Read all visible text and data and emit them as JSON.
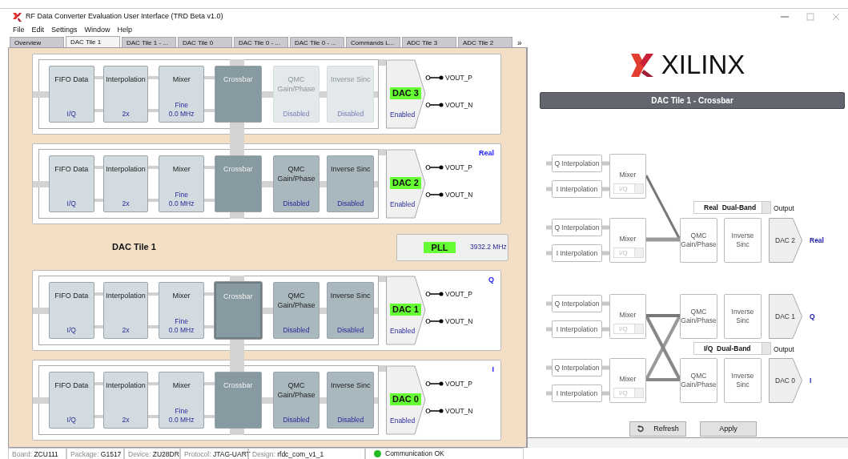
{
  "window": {
    "title": "RF Data Converter Evaluation User Interface (TRD Beta v1.0)"
  },
  "menu": [
    "File",
    "Edit",
    "Settings",
    "Window",
    "Help"
  ],
  "tabs": [
    {
      "label": "Overview",
      "selected": false
    },
    {
      "label": "DAC Tile 1",
      "selected": true
    },
    {
      "label": "DAC Tile 1 - ...",
      "selected": false
    },
    {
      "label": "DAC Tile 0",
      "selected": false
    },
    {
      "label": "DAC Tile 0 - ...",
      "selected": false
    },
    {
      "label": "DAC Tile 0 - ...",
      "selected": false
    },
    {
      "label": "Commands L...",
      "selected": false
    },
    {
      "label": "ADC Tile 3",
      "selected": false
    },
    {
      "label": "ADC Tile 2",
      "selected": false
    }
  ],
  "tabs_more": "»",
  "dac_tile": {
    "label": "DAC Tile 1",
    "pll": {
      "label": "PLL",
      "frequency": "3932.2 MHz"
    },
    "pairs": [
      [
        {
          "fifo": {
            "title": "FIFO Data",
            "value": "I/Q"
          },
          "interpolation": {
            "title": "Interpolation",
            "value": "2x"
          },
          "mixer": {
            "title": "Mixer",
            "value": "Fine",
            "frequency": "0.0 MHz"
          },
          "crossbar": {
            "title": "Crossbar",
            "selected": false
          },
          "qmc": {
            "title": "QMC Gain/Phase",
            "value": "Disabled",
            "disabled": true
          },
          "inverse_sinc": {
            "title": "Inverse Sinc",
            "value": "Disabled",
            "disabled": true
          },
          "dac": {
            "name": "DAC 3",
            "status": "Enabled"
          },
          "outputs": [
            "VOUT_P",
            "VOUT_N"
          ]
        },
        {
          "tag": "Real",
          "fifo": {
            "title": "FIFO Data",
            "value": "I/Q"
          },
          "interpolation": {
            "title": "Interpolation",
            "value": "2x"
          },
          "mixer": {
            "title": "Mixer",
            "value": "Fine",
            "frequency": "0.0 MHz"
          },
          "crossbar": {
            "title": "Crossbar",
            "selected": false
          },
          "qmc": {
            "title": "QMC Gain/Phase",
            "value": "Disabled",
            "disabled": false
          },
          "inverse_sinc": {
            "title": "Inverse Sinc",
            "value": "Disabled",
            "disabled": false
          },
          "dac": {
            "name": "DAC 2",
            "status": "Enabled"
          },
          "outputs": [
            "VOUT_P",
            "VOUT_N"
          ]
        }
      ],
      [
        {
          "tag": "Q",
          "fifo": {
            "title": "FIFO Data",
            "value": "I/Q"
          },
          "interpolation": {
            "title": "Interpolation",
            "value": "2x"
          },
          "mixer": {
            "title": "Mixer",
            "value": "Fine",
            "frequency": "0.0 MHz"
          },
          "crossbar": {
            "title": "Crossbar",
            "selected": true
          },
          "qmc": {
            "title": "QMC Gain/Phase",
            "value": "Disabled",
            "disabled": false
          },
          "inverse_sinc": {
            "title": "Inverse Sinc",
            "value": "Disabled",
            "disabled": false
          },
          "dac": {
            "name": "DAC 1",
            "status": "Enabled"
          },
          "outputs": [
            "VOUT_P",
            "VOUT_N"
          ]
        },
        {
          "tag": "I",
          "fifo": {
            "title": "FIFO Data",
            "value": "I/Q"
          },
          "interpolation": {
            "title": "Interpolation",
            "value": "2x"
          },
          "mixer": {
            "title": "Mixer",
            "value": "Fine",
            "frequency": "0.0 MHz"
          },
          "crossbar": {
            "title": "Crossbar",
            "selected": false
          },
          "qmc": {
            "title": "QMC Gain/Phase",
            "value": "Disabled",
            "disabled": false
          },
          "inverse_sinc": {
            "title": "Inverse Sinc",
            "value": "Disabled",
            "disabled": false
          },
          "dac": {
            "name": "DAC 0",
            "status": "Enabled"
          },
          "outputs": [
            "VOUT_P",
            "VOUT_N"
          ]
        }
      ]
    ]
  },
  "crossbar_panel": {
    "logo": "XILINX",
    "title": "DAC Tile 1 - Crossbar",
    "groups": [
      {
        "kind": "merge",
        "output_select": "Real  Dual-Band",
        "output_label": "Output",
        "mixers": [
          {
            "inputs": [
              "Q Interpolation",
              "I Interpolation"
            ],
            "title": "Mixer",
            "mode": "I/Q"
          },
          {
            "inputs": [
              "Q Interpolation",
              "I Interpolation"
            ],
            "title": "Mixer",
            "mode": "I/Q"
          }
        ],
        "paths": [
          {
            "qmc": "QMC Gain/Phase",
            "inverse_sinc": "Inverse Sinc",
            "dac": "DAC 2",
            "label": "Real"
          }
        ]
      },
      {
        "kind": "cross",
        "output_select": "I/Q  Dual-Band",
        "output_label": "Output",
        "mixers": [
          {
            "inputs": [
              "Q Interpolation",
              "I Interpolation"
            ],
            "title": "Mixer",
            "mode": "I/Q"
          },
          {
            "inputs": [
              "Q Interpolation",
              "I Interpolation"
            ],
            "title": "Mixer",
            "mode": "I/Q"
          }
        ],
        "paths": [
          {
            "qmc": "QMC Gain/Phase",
            "inverse_sinc": "Inverse Sinc",
            "dac": "DAC 1",
            "label": "Q"
          },
          {
            "qmc": "QMC Gain/Phase",
            "inverse_sinc": "Inverse Sinc",
            "dac": "DAC 0",
            "label": "I"
          }
        ]
      }
    ],
    "buttons": [
      {
        "kind": "refresh",
        "label": "Refresh"
      },
      {
        "kind": "apply",
        "label": "Apply"
      }
    ]
  },
  "status_bar": [
    {
      "label": "Board:",
      "value": "ZCU111"
    },
    {
      "label": "Package:",
      "value": "G1517"
    },
    {
      "label": "Device:",
      "value": "ZU28DR"
    },
    {
      "label": "Protocol:",
      "value": "JTAG-UART"
    },
    {
      "label": "Design:",
      "value": "rfdc_com_v1_1"
    }
  ],
  "connection": {
    "text": "Communication OK",
    "ok": true
  }
}
